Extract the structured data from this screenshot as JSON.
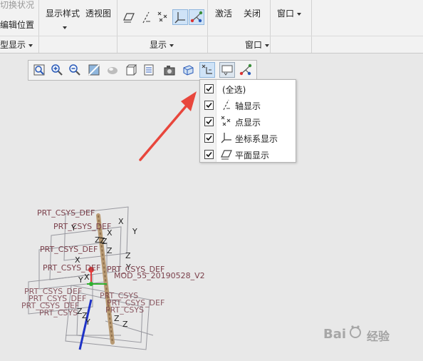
{
  "ribbon": {
    "left_items": {
      "switch_status": "切换状况",
      "edit_position": "编辑位置"
    },
    "display_style": "显示样式",
    "perspective_view": "透视图",
    "activate": "激活",
    "close": "关闭",
    "window_menu": "窗口",
    "group_labels": {
      "model_display": "型显示",
      "display": "显示",
      "window": "窗口"
    }
  },
  "display_filter_menu": {
    "items": [
      {
        "label": "(全选)",
        "checked": true,
        "icon": "none"
      },
      {
        "label": "轴显示",
        "checked": true,
        "icon": "axis-display-icon"
      },
      {
        "label": "点显示",
        "checked": true,
        "icon": "point-display-icon"
      },
      {
        "label": "坐标系显示",
        "checked": true,
        "icon": "csys-display-icon"
      },
      {
        "label": "平面显示",
        "checked": true,
        "icon": "plane-display-icon"
      }
    ]
  },
  "model_labels": {
    "csys_1": "PRT_CSYS_DEF",
    "csys_2": "PRT_CSYS_DEF",
    "csys_3": "PRT_CSYS_DEF",
    "csys_4": "PRT_CSYS_DEF",
    "csys_5": "PRT_CSYS_DEF",
    "model_name": "MOD_55_20190528_V2",
    "axis_x": "X",
    "axis_y": "Y",
    "axis_z": "Z"
  },
  "watermark": {
    "text": "经验"
  },
  "colors": {
    "accent_active": "#cfe3f7",
    "arrow": "#e8463c",
    "model_label": "#7a3f4a"
  }
}
